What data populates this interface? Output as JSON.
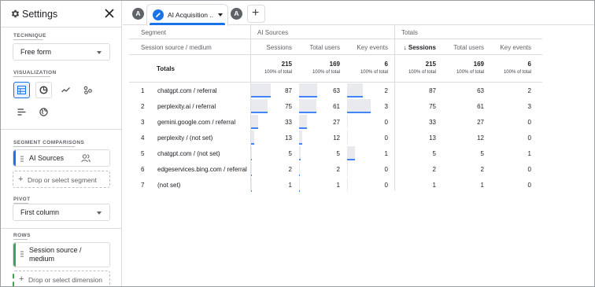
{
  "settings": {
    "title": "Settings",
    "sections": {
      "technique": "TECHNIQUE",
      "visualization": "VISUALIZATION",
      "segment_comparisons": "SEGMENT COMPARISONS",
      "pivot": "PIVOT",
      "rows": "ROWS"
    },
    "technique_value": "Free form",
    "pivot_value": "First column",
    "segment_chip": "AI Sources",
    "drop_segment": "Drop or select segment",
    "row_dimension_line1": "Session source /",
    "row_dimension_line2": "medium",
    "drop_dimension": "Drop or select dimension",
    "viz_icons": [
      "table-icon",
      "donut-chart-icon",
      "line-chart-icon",
      "scatter-plot-icon",
      "bar-chart-icon",
      "geo-map-icon"
    ]
  },
  "tabs": {
    "left_avatar": "A",
    "active_label": "AI Acquisition ..",
    "right_avatar": "A",
    "add": "+"
  },
  "table": {
    "headers": {
      "segment": "Segment",
      "ai_sources": "AI Sources",
      "totals": "Totals",
      "dimension": "Session source / medium",
      "sessions": "Sessions",
      "total_users": "Total users",
      "key_events": "Key events",
      "sort_sessions": "↓ Sessions",
      "totals_row": "Totals",
      "pct_total": "100% of total"
    },
    "totals": {
      "ai": {
        "sessions": "215",
        "users": "169",
        "key_events": "6"
      },
      "all": {
        "sessions": "215",
        "users": "169",
        "key_events": "6"
      }
    },
    "rows": [
      {
        "n": "1",
        "dim": "chatgpt.com / referral",
        "s": "87",
        "u": "63",
        "k": "2",
        "ts": "87",
        "tu": "63",
        "tk": "2",
        "sf": 0.405,
        "uf": 0.373,
        "kf": 0.333
      },
      {
        "n": "2",
        "dim": "perplexity.ai / referral",
        "s": "75",
        "u": "61",
        "k": "3",
        "ts": "75",
        "tu": "61",
        "tk": "3",
        "sf": 0.349,
        "uf": 0.361,
        "kf": 0.5
      },
      {
        "n": "3",
        "dim": "gemini.google.com / referral",
        "s": "33",
        "u": "27",
        "k": "0",
        "ts": "33",
        "tu": "27",
        "tk": "0",
        "sf": 0.153,
        "uf": 0.16,
        "kf": 0
      },
      {
        "n": "4",
        "dim": "perplexity / (not set)",
        "s": "13",
        "u": "12",
        "k": "0",
        "ts": "13",
        "tu": "12",
        "tk": "0",
        "sf": 0.06,
        "uf": 0.071,
        "kf": 0
      },
      {
        "n": "5",
        "dim": "chatgpt.com / (not set)",
        "s": "5",
        "u": "5",
        "k": "1",
        "ts": "5",
        "tu": "5",
        "tk": "1",
        "sf": 0.023,
        "uf": 0.03,
        "kf": 0.167
      },
      {
        "n": "6",
        "dim": "edgeservices.bing.com / referral",
        "s": "2",
        "u": "2",
        "k": "0",
        "ts": "2",
        "tu": "2",
        "tk": "0",
        "sf": 0.009,
        "uf": 0.012,
        "kf": 0
      },
      {
        "n": "7",
        "dim": "(not set)",
        "s": "1",
        "u": "1",
        "k": "0",
        "ts": "1",
        "tu": "1",
        "tk": "0",
        "sf": 0.005,
        "uf": 0.006,
        "kf": 0
      }
    ]
  }
}
